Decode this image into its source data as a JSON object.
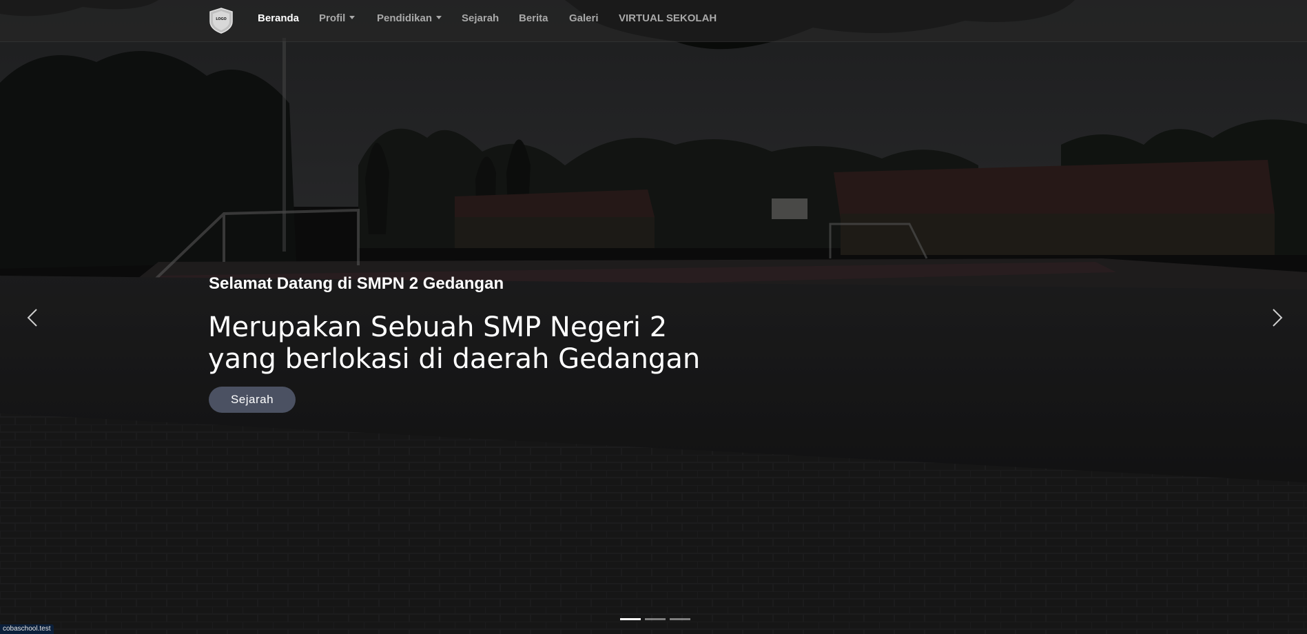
{
  "brand": {
    "logo_text": "LOGO",
    "icon": "school-shield-logo"
  },
  "nav": {
    "items": [
      {
        "label": "Beranda",
        "active": true,
        "dropdown": false
      },
      {
        "label": "Profil",
        "active": false,
        "dropdown": true
      },
      {
        "label": "Pendidikan",
        "active": false,
        "dropdown": true
      },
      {
        "label": "Sejarah",
        "active": false,
        "dropdown": false
      },
      {
        "label": "Berita",
        "active": false,
        "dropdown": false
      },
      {
        "label": "Galeri",
        "active": false,
        "dropdown": false
      },
      {
        "label": "VIRTUAL SEKOLAH",
        "active": false,
        "dropdown": false
      }
    ]
  },
  "hero": {
    "subtitle": "Selamat Datang di SMPN 2 Gedangan",
    "title": "Merupakan Sebuah SMP Negeri 2 yang berlokasi di daerah Gedangan",
    "button_label": "Sejarah"
  },
  "carousel": {
    "prev_icon": "chevron-left-icon",
    "next_icon": "chevron-right-icon",
    "slides_total": 3,
    "active_slide": 1
  },
  "status_bar": {
    "url": "cobaschool.test"
  },
  "colors": {
    "nav_active": "#ffffff",
    "nav_inactive": "#a9a9a9",
    "button_bg": "#4b5162"
  }
}
